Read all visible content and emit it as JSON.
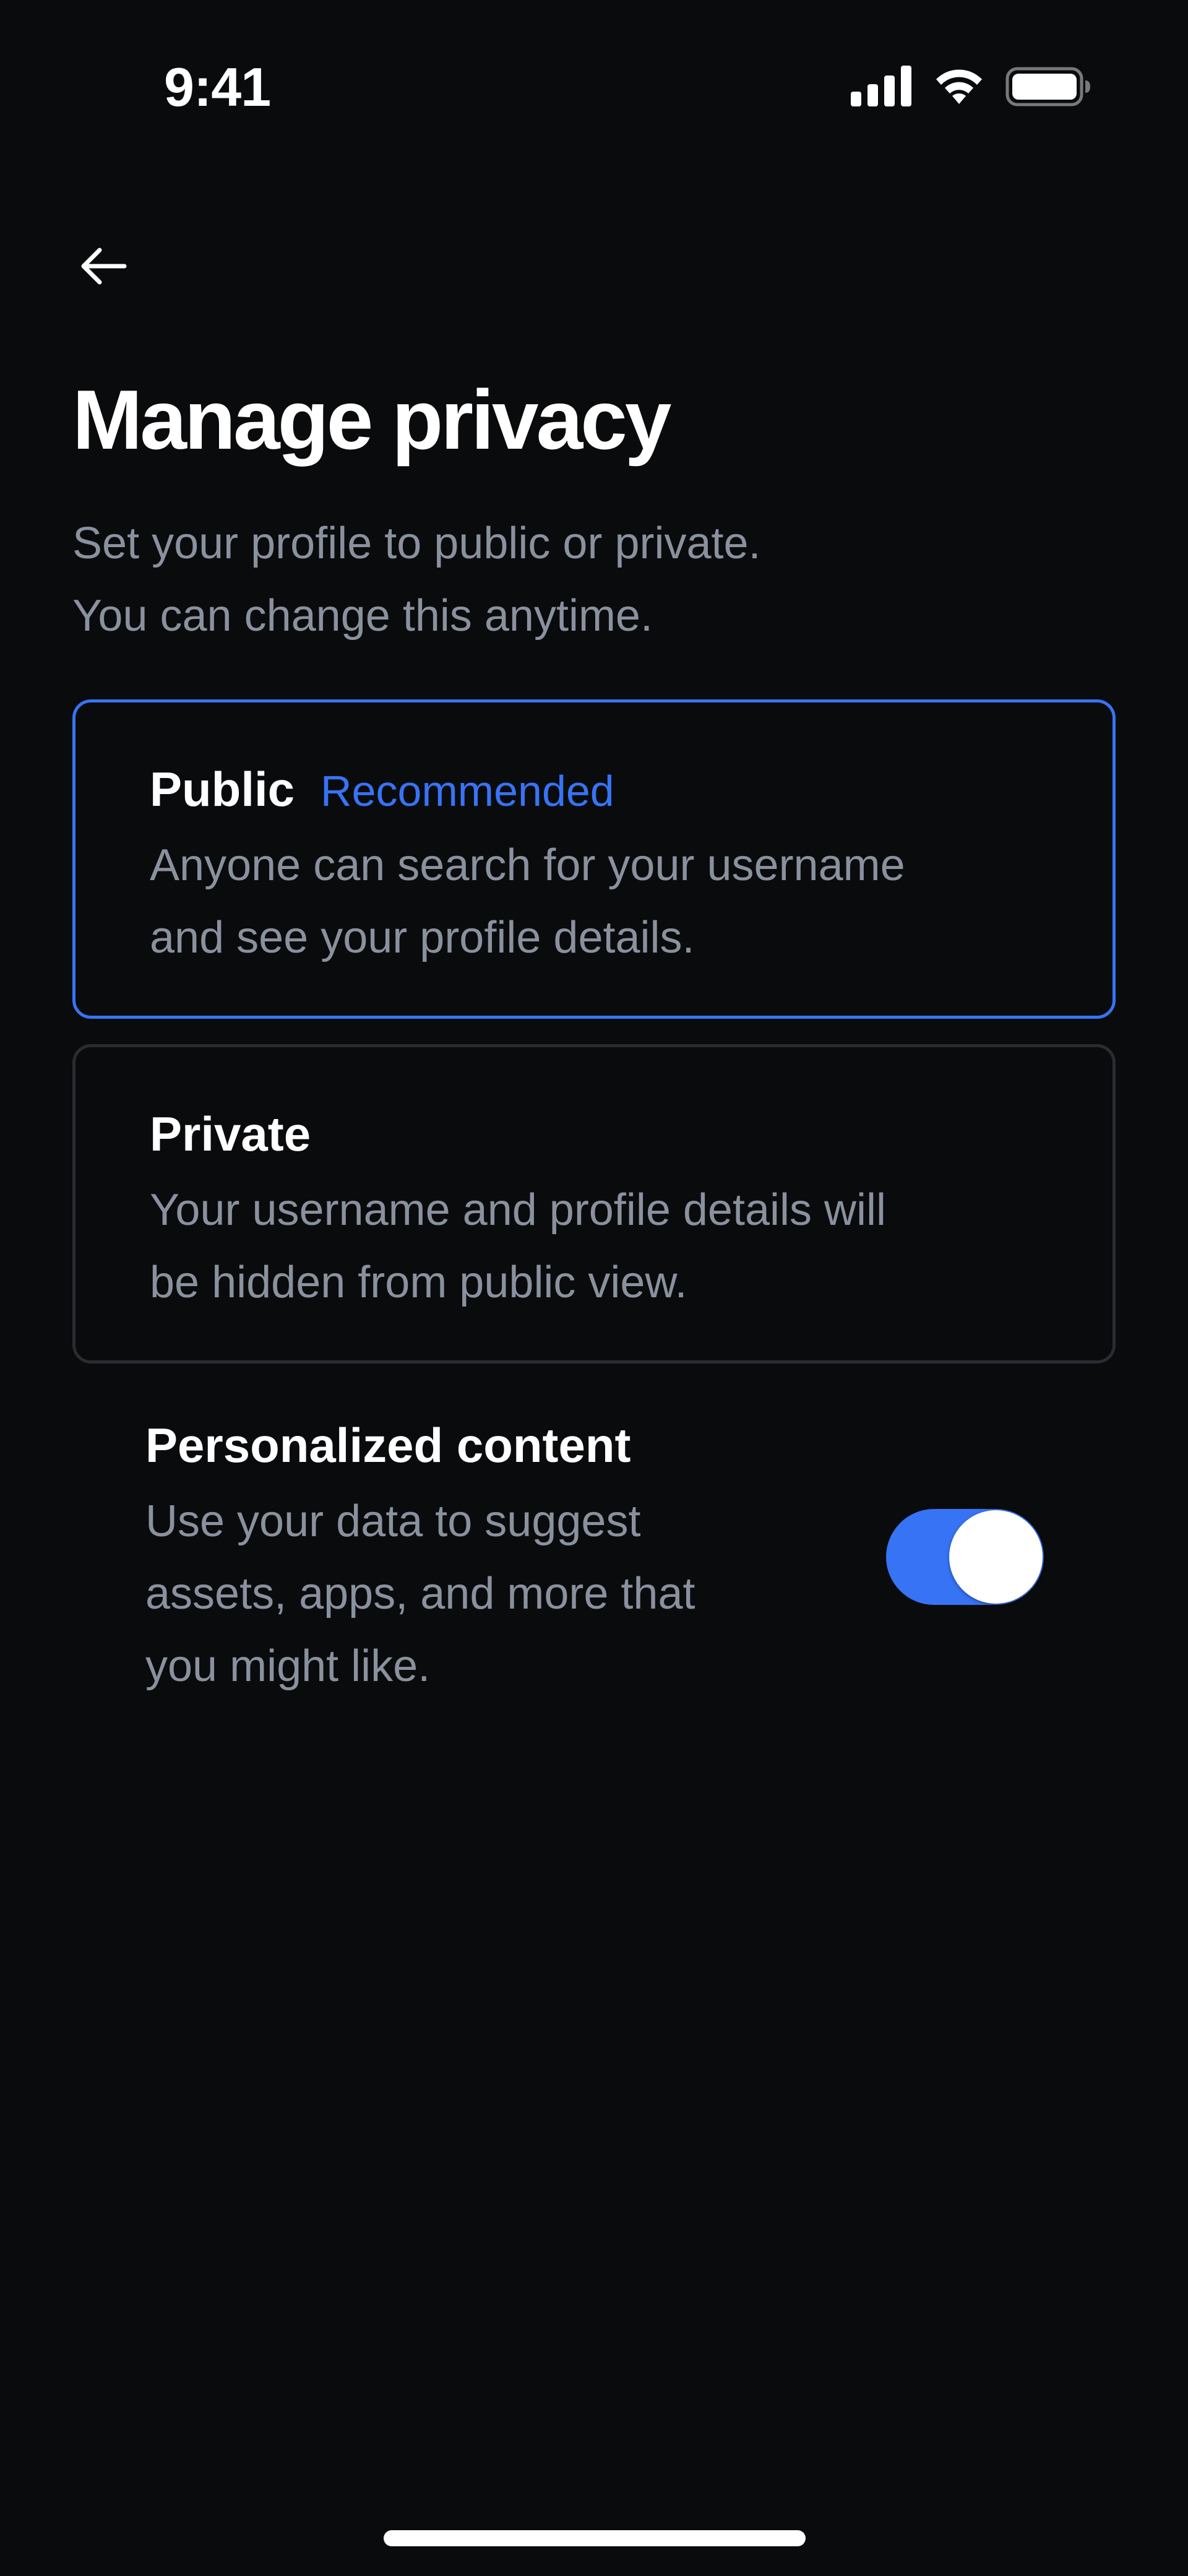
{
  "status_bar": {
    "time": "9:41",
    "icons": [
      "cellular-signal-icon",
      "wifi-icon",
      "battery-icon"
    ],
    "battery_level": 1.0
  },
  "nav": {
    "back_icon": "arrow-left-icon"
  },
  "header": {
    "title": "Manage privacy",
    "subtitle_lines": [
      "Set your profile to public or private.",
      "You can change this anytime."
    ]
  },
  "options": [
    {
      "title": "Public",
      "badge": "Recommended",
      "description_lines": [
        "Anyone can search for your username",
        "and see your profile details."
      ],
      "selected": true
    },
    {
      "title": "Private",
      "badge": "",
      "description_lines": [
        "Your username and profile details will",
        "be hidden from public view."
      ],
      "selected": false
    }
  ],
  "personalized": {
    "title": "Personalized content",
    "description_lines": [
      "Use your data to suggest",
      "assets, apps, and more that",
      "you might like."
    ],
    "enabled": true
  },
  "colors": {
    "background": "#0a0b0d",
    "accent": "#3773f5",
    "secondary_text": "#8a919e",
    "card_border": "#2a2c32"
  }
}
